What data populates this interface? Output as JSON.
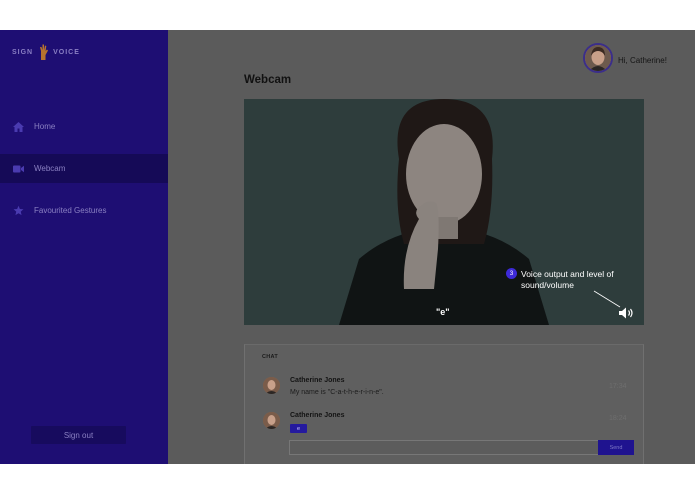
{
  "brand": {
    "left": "SIGN",
    "right": "VOICE"
  },
  "sidebar": {
    "items": [
      {
        "label": "Home",
        "icon": "home-icon",
        "active": false
      },
      {
        "label": "Webcam",
        "icon": "video-camera-icon",
        "active": true
      },
      {
        "label": "Favourited Gestures",
        "icon": "star-icon",
        "active": false
      }
    ],
    "signout_label": "Sign out"
  },
  "header": {
    "greeting": "Hi, Catherine!"
  },
  "page": {
    "title": "Webcam"
  },
  "video": {
    "caption": "\"e\"",
    "annotation": {
      "number": "3",
      "text": "Voice output and level of sound/volume"
    }
  },
  "chat": {
    "title": "CHAT",
    "messages": [
      {
        "name": "Catherine Jones",
        "text": "My name is \"C-a-t-h-e-r-i-n-e\".",
        "time": "17:34"
      },
      {
        "name": "Catherine Jones",
        "text": "e",
        "time": "18:24"
      }
    ],
    "input_value": "",
    "send_label": "Send"
  },
  "colors": {
    "sidebar": "#1e0e73",
    "accent": "#3d2ad8",
    "overlay": "#5b5b5b"
  }
}
